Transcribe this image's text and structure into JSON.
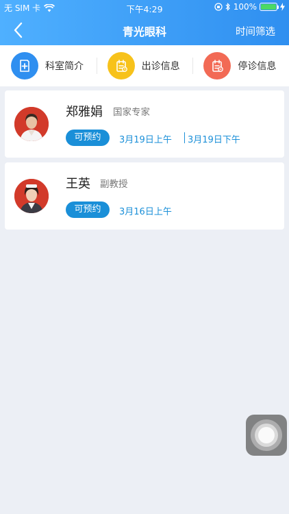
{
  "status_bar": {
    "carrier": "无 SIM 卡",
    "time": "下午4:29",
    "battery": "100%",
    "battery_level": 1.0
  },
  "nav": {
    "title": "青光眼科",
    "filter_label": "时间筛选",
    "back_icon": "chevron-left-icon"
  },
  "shortcuts": [
    {
      "label": "科室简介",
      "icon": "department-intro-icon",
      "color": "#2f8ff0"
    },
    {
      "label": "出诊信息",
      "icon": "clinic-schedule-icon",
      "color": "#f7c21b"
    },
    {
      "label": "停诊信息",
      "icon": "clinic-suspended-icon",
      "color": "#f26a55"
    }
  ],
  "doctors": [
    {
      "name": "郑雅娟",
      "title": "国家专家",
      "status": "可预约",
      "slots": [
        "3月19日上午",
        "3月19日下午"
      ]
    },
    {
      "name": "王英",
      "title": "副教授",
      "status": "可预约",
      "slots": [
        "3月16日上午"
      ]
    }
  ],
  "colors": {
    "header": "#3a9bf3",
    "accent": "#1a8fd8",
    "background": "#eceff5",
    "avatar_bg": "#d23a2a"
  }
}
